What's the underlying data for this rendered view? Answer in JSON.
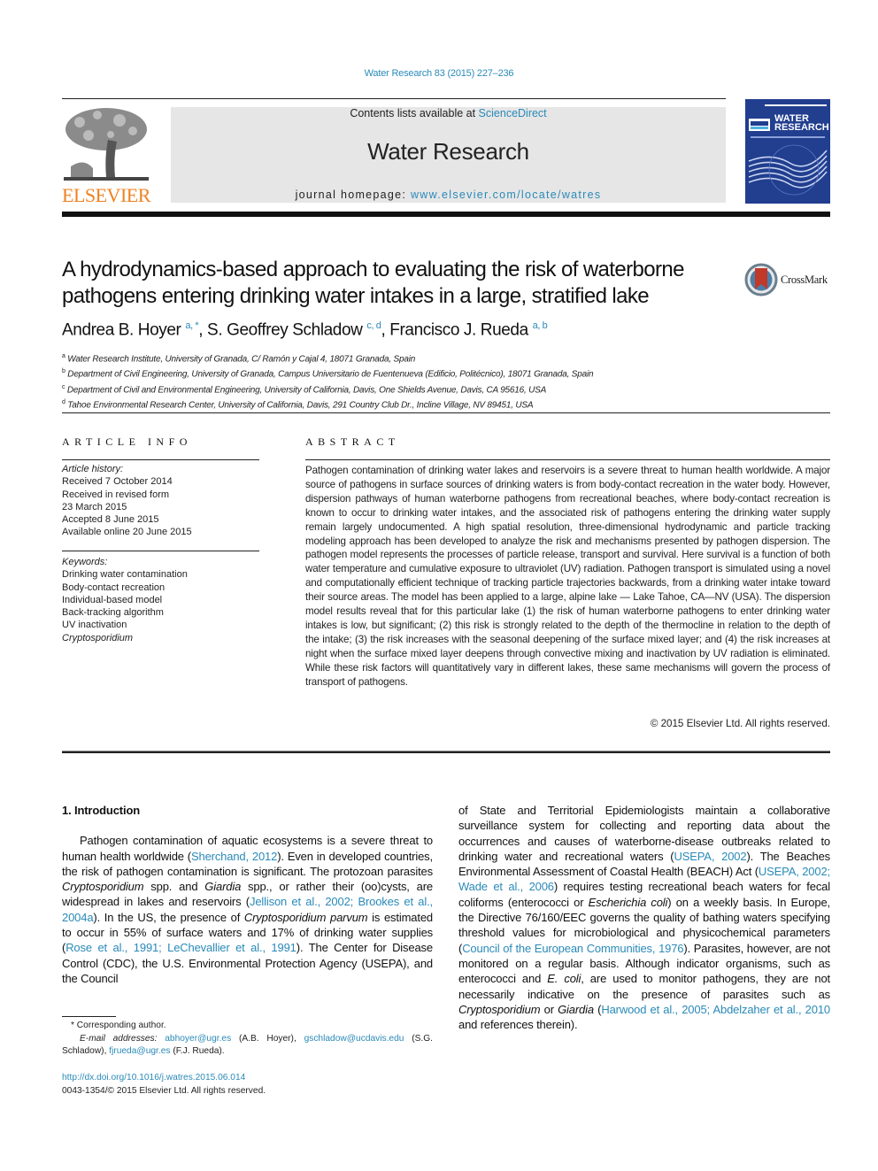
{
  "header": {
    "citation": "Water Research 83 (2015) 227–236",
    "publisher_logo_text": "ELSEVIER",
    "contents_prefix": "Contents lists available at ",
    "contents_link": "ScienceDirect",
    "journal_name": "Water Research",
    "homepage_prefix": "journal homepage: ",
    "homepage_link": "www.elsevier.com/locate/watres",
    "cover_title_line1": "WATER",
    "cover_title_line2": "RESEARCH",
    "crossmark_label": "CrossMark"
  },
  "article": {
    "title_line1": "A hydrodynamics-based approach to evaluating the risk of waterborne",
    "title_line2": "pathogens entering drinking water intakes in a large, stratified lake",
    "authors": [
      {
        "name": "Andrea B. Hoyer",
        "sup": "a, *",
        "sep": ", "
      },
      {
        "name": "S. Geoffrey Schladow",
        "sup": "c, d",
        "sep": ", "
      },
      {
        "name": "Francisco J. Rueda",
        "sup": "a, b",
        "sep": ""
      }
    ],
    "affiliations": [
      {
        "key": "a",
        "text": "Water Research Institute, University of Granada, C/ Ramón y Cajal 4, 18071 Granada, Spain"
      },
      {
        "key": "b",
        "text": "Department of Civil Engineering, University of Granada, Campus Universitario de Fuentenueva (Edificio, Politécnico), 18071 Granada, Spain"
      },
      {
        "key": "c",
        "text": "Department of Civil and Environmental Engineering, University of California, Davis, One Shields Avenue, Davis, CA 95616, USA"
      },
      {
        "key": "d",
        "text": "Tahoe Environmental Research Center, University of California, Davis, 291 Country Club Dr., Incline Village, NV 89451, USA"
      }
    ]
  },
  "article_info": {
    "heading": "ARTICLE INFO",
    "history_label": "Article history:",
    "history": [
      "Received 7 October 2014",
      "Received in revised form",
      "23 March 2015",
      "Accepted 8 June 2015",
      "Available online 20 June 2015"
    ],
    "keywords_label": "Keywords:",
    "keywords": [
      "Drinking water contamination",
      "Body-contact recreation",
      "Individual-based model",
      "Back-tracking algorithm",
      "UV inactivation",
      "Cryptosporidium"
    ]
  },
  "abstract": {
    "heading": "ABSTRACT",
    "text": "Pathogen contamination of drinking water lakes and reservoirs is a severe threat to human health worldwide. A major source of pathogens in surface sources of drinking waters is from body-contact recreation in the water body. However, dispersion pathways of human waterborne pathogens from recreational beaches, where body-contact recreation is known to occur to drinking water intakes, and the associated risk of pathogens entering the drinking water supply remain largely undocumented. A high spatial resolution, three-dimensional hydrodynamic and particle tracking modeling approach has been developed to analyze the risk and mechanisms presented by pathogen dispersion. The pathogen model represents the processes of particle release, transport and survival. Here survival is a function of both water temperature and cumulative exposure to ultraviolet (UV) radiation. Pathogen transport is simulated using a novel and computationally efficient technique of tracking particle trajectories back­wards, from a drinking water intake toward their source areas. The model has been applied to a large, alpine lake — Lake Tahoe, CA—NV (USA). The dispersion model results reveal that for this particular lake (1) the risk of human waterborne pathogens to enter drinking water intakes is low, but significant; (2) this risk is strongly related to the depth of the thermocline in relation to the depth of the intake; (3) the risk increases with the seasonal deepening of the surface mixed layer; and (4) the risk increases at night when the surface mixed layer deepens through convective mixing and inactivation by UV radiation is eliminated. While these risk factors will quantitatively vary in different lakes, these same mechanisms will govern the process of transport of pathogens.",
    "copyright": "© 2015 Elsevier Ltd. All rights reserved."
  },
  "body": {
    "intro_heading": "1.  Introduction",
    "left": {
      "p1": "Pathogen contamination of aquatic ecosystems is a severe threat to human health worldwide (",
      "l1": "Sherchand, 2012",
      "p2": "). Even in developed countries, the risk of pathogen contamination is significant. The protozoan parasites ",
      "i1": "Cryptosporidium",
      "p3": " spp. and ",
      "i2": "Giardia",
      "p4": " spp., or rather their (oo)cysts, are widespread in lakes and reservoirs (",
      "l2": "Jellison et al., 2002; Brookes et al., 2004a",
      "p5": "). In the US, the presence of ",
      "i3": "Cryptosporidium parvum",
      "p6": " is estimated to occur in 55% of surface waters and 17% of drinking water supplies (",
      "l3": "Rose et al., 1991; LeChevallier et al., 1991",
      "p7": "). The Center for Disease Control (CDC), the U.S. Environmental Protection Agency (USEPA), and the Council"
    },
    "right": {
      "p1": "of State and Territorial Epidemiologists maintain a collaborative surveillance system for collecting and reporting data about the occurrences and causes of waterborne-disease outbreaks related to drinking water and recreational waters (",
      "l1": "USEPA, 2002",
      "p2": "). The Beaches Environmental Assessment of Coastal Health (BEACH) Act (",
      "l2": "USEPA, 2002; Wade et al., 2006",
      "p3": ") requires testing recreational beach wa­ters for fecal coliforms (enterococci or ",
      "i1": "Escherichia coli",
      "p4": ") on a weekly basis. In Europe, the Directive 76/160/EEC governs the quality of bathing waters specifying threshold values for microbiological and physicochemical parameters (",
      "l3": "Council of the European Communities, 1976",
      "p5": "). Parasites, however, are not monitored on a regular basis. Although indicator organisms, such as enterococci and ",
      "i2": "E. coli",
      "p6": ", are used to monitor pathogens, they are not necessarily indicative on the presence of parasites such as ",
      "i3": "Cryptosporidium",
      "p7": " or ",
      "i4": "Giardia",
      "p8": " (",
      "l4": "Harwood et al., 2005; Abdelzaher et al., 2010",
      "p9": " and refer­ences therein)."
    }
  },
  "footnotes": {
    "corresponding": "* Corresponding author.",
    "email_label": "E-mail addresses:",
    "emails": [
      {
        "address": "abhoyer@ugr.es",
        "owner": " (A.B. Hoyer), "
      },
      {
        "address": "gschladow@ucdavis.edu",
        "owner": " (S.G. Schladow), "
      },
      {
        "address": "fjrueda@ugr.es",
        "owner": " (F.J. Rueda)."
      }
    ],
    "doi": "http://dx.doi.org/10.1016/j.watres.2015.06.014",
    "issn": "0043-1354/© 2015 Elsevier Ltd. All rights reserved."
  },
  "colors": {
    "link": "#2a8ab8",
    "elsevier_orange": "#f08220",
    "cover_blue": "#213e8f",
    "masthead_gray": "#e6e6e6"
  }
}
